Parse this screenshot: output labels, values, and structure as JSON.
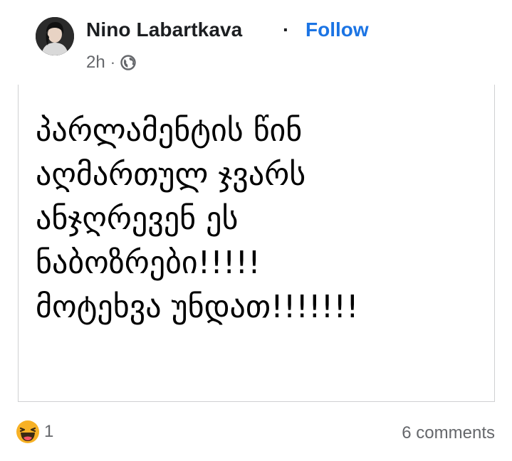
{
  "post": {
    "author": "Nino Labartkava",
    "separator": "·",
    "follow_label": "Follow",
    "time": "2h",
    "meta_separator": "·",
    "audience_icon": "globe-icon",
    "text": "პარლამენტის წინ\nაღმართულ ჯვარს\nანჯღრევენ ეს\nნაბოზრები!!!!!\nმოტეხვა უნდათ!!!!!!!",
    "reaction_icon": "haha-icon",
    "reaction_count": "1",
    "comments_label": "6 comments"
  },
  "colors": {
    "follow": "#1b74e4",
    "secondary_text": "#65676b",
    "reaction_yellow": "#f7b125"
  }
}
